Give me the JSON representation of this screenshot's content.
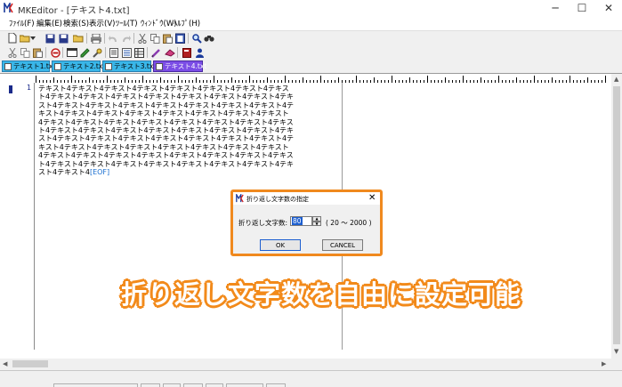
{
  "window": {
    "title": "MKEditor - [テキスト4.txt]",
    "min_glyph": "─",
    "max_glyph": "☐",
    "close_glyph": "✕"
  },
  "menu": [
    "ﾌｧｲﾙ(F)",
    "編集(E)",
    "検索(S)",
    "表示(V)",
    "ﾂｰﾙ(T)",
    "ｳｨﾝﾄﾞｳ(W)",
    "ﾍﾙﾌﾟ(H)"
  ],
  "tabs": [
    {
      "label": "テキスト1.txt"
    },
    {
      "label": "テキスト2.txt"
    },
    {
      "label": "テキスト3.txt"
    },
    {
      "label": "テキスト4.txt",
      "active": true
    }
  ],
  "editor": {
    "line_number": "1",
    "lines": [
      "テキスト4テキスト4テキスト4テキスト4テキスト4テキスト4テキスト4テキス",
      "ト4テキスト4テキスト4テキスト4テキスト4テキスト4テキスト4テキスト4テキ",
      "スト4テキスト4テキスト4テキスト4テキスト4テキスト4テキスト4テキスト4テ",
      "キスト4テキスト4テキスト4テキスト4テキスト4テキスト4テキスト4テキスト",
      "4テキスト4テキスト4テキスト4テキスト4テキスト4テキスト4テキスト4テキス",
      "ト4テキスト4テキスト4テキスト4テキスト4テキスト4テキスト4テキスト4テキ",
      "スト4テキスト4テキスト4テキスト4テキスト4テキスト4テキスト4テキスト4テ",
      "キスト4テキスト4テキスト4テキスト4テキスト4テキスト4テキスト4テキスト",
      "4テキスト4テキスト4テキスト4テキスト4テキスト4テキスト4テキスト4テキス",
      "ト4テキスト4テキスト4テキスト4テキスト4テキスト4テキスト4テキスト4テキ",
      "スト4テキスト4"
    ],
    "eof": "[EOF]"
  },
  "dialog": {
    "title": "折り返し文字数の指定",
    "label": "折り返し文字数:",
    "value": "80",
    "range": "( 20 ～ 2000 )",
    "ok": "OK",
    "cancel": "CANCEL"
  },
  "caption": "折り返し文字数を自由に設定可能",
  "colors": {
    "tab_inactive": "#39b6e8",
    "tab_active": "#7b4de6",
    "accent_orange": "#f0891e"
  }
}
